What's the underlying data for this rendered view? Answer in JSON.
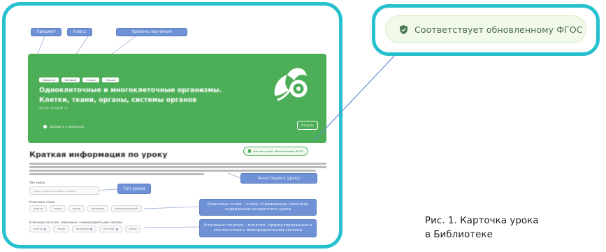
{
  "badge": {
    "text": "Соответствует обновленному ФГОС",
    "accent": "#27c0cf",
    "green": "#4cae57"
  },
  "caption": {
    "line1": "Рис. 1. Карточка урока",
    "line2": "в Библиотеке"
  },
  "callouts": {
    "subject": "Предмет",
    "class": "Класс",
    "education_level": "Уровень изучения",
    "lesson_type": "Тип урока",
    "annotation": "Аннотация к уроку",
    "keywords": "Ключевые слова – слова, отражающие тематику содержания конкретного урока",
    "key_concepts": "Ключевые понятия – понятия, сформулированные в соответствии с межпредметными связями"
  },
  "lesson": {
    "chips": [
      "Биология",
      "Базовый",
      "5 класс",
      "Лекция"
    ],
    "title": "Одноклеточные и многоклеточные организмы. Клетки, ткани, органы, системы органов",
    "author": "Автор: Бонд И. Н.",
    "favorite": "Добавить в избранное",
    "open_button": "Открыть",
    "section_title": "Краткая информация по уроку",
    "fgos_small": "Соответствует обновленному ФГОС",
    "lesson_type_label": "Тип урока",
    "lesson_type_value": "Урок открытия нового знания",
    "keywords_label": "Ключевые слова",
    "keywords": [
      "клетка",
      "ткань",
      "орган",
      "организм",
      "многоклеточный"
    ],
    "concepts_label": "Ключевые понятия, связанные с межпредметными связями",
    "concepts": [
      "клетка",
      "ткань",
      "организм",
      "система",
      "орган"
    ]
  }
}
